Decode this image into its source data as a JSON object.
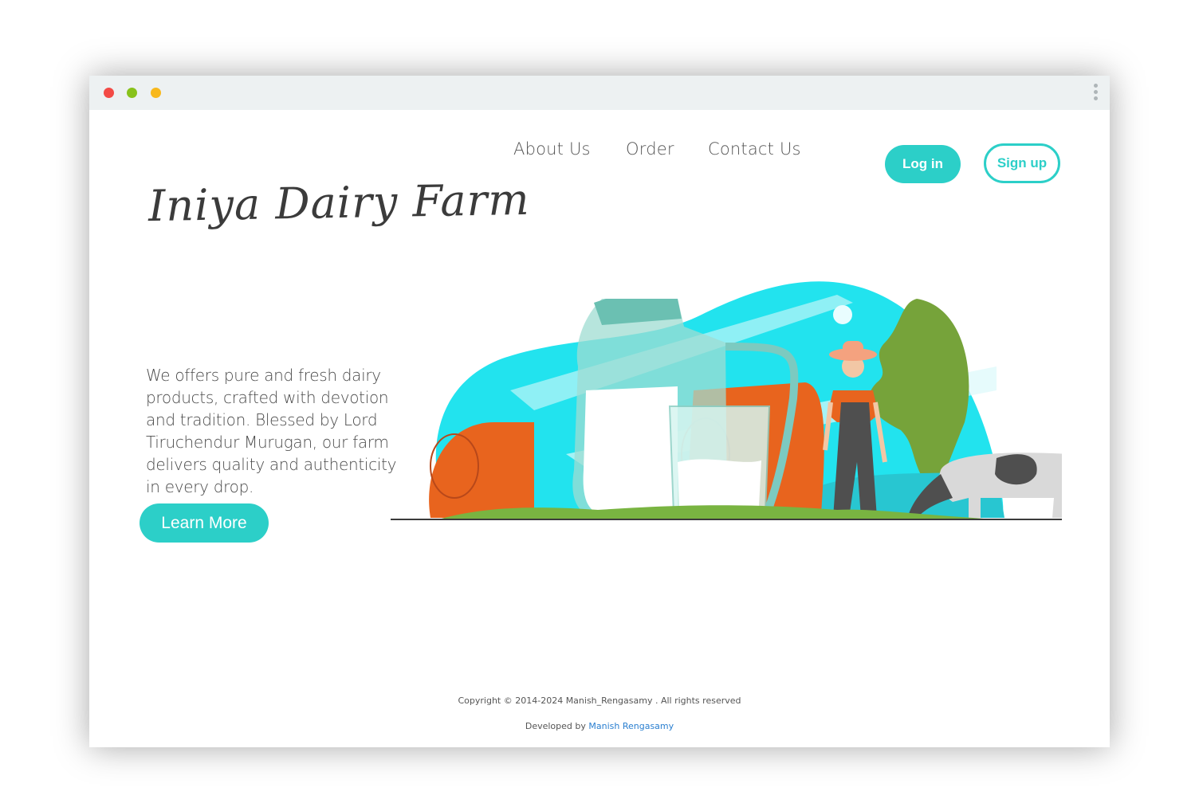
{
  "window": {
    "controls": [
      "close",
      "minimize",
      "zoom"
    ],
    "menu_icon": "kebab-menu-icon"
  },
  "nav": {
    "about": "About Us",
    "order": "Order",
    "contact": "Contact Us"
  },
  "auth": {
    "login": "Log in",
    "signup": "Sign up"
  },
  "brand": {
    "name": "Iniya Dairy Farm"
  },
  "hero": {
    "tagline": "We offers pure and fresh dairy products, crafted with devotion and tradition. Blessed by Lord Tiruchendur Murugan, our farm delivers quality and authenticity in every drop.",
    "cta": "Learn More",
    "illustration": "farm-illustration-milk-jug-farmer-cow"
  },
  "footer": {
    "copyright": "Copyright © 2014-2024 Manish_Rengasamy . All rights reserved",
    "developed_prefix": "Developed by ",
    "developer": "Manish Rengasamy"
  },
  "colors": {
    "accent": "#2ccfc8",
    "sky": "#22e3ee",
    "hay": "#e8641e",
    "foliage": "#76a33a"
  }
}
